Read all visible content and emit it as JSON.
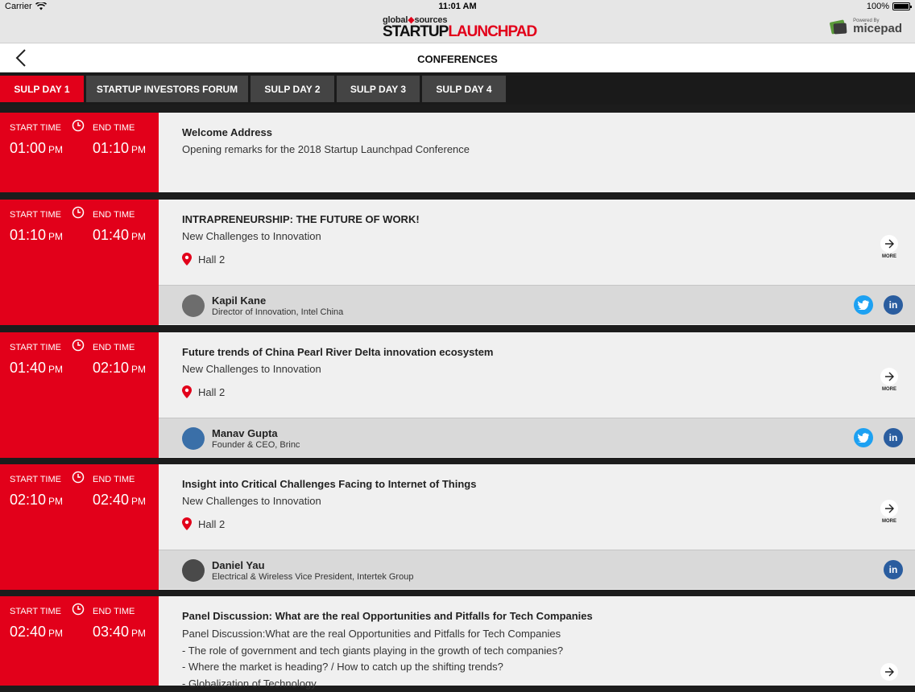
{
  "status_bar": {
    "carrier": "Carrier",
    "time": "11:01 AM",
    "battery": "100%"
  },
  "brand": {
    "small_left": "global",
    "small_right": "sources",
    "startup": "STARTUP",
    "launchpad": "LAUNCHPAD",
    "powered_by": "Powered By",
    "micepad": "micepad"
  },
  "header": {
    "title": "CONFERENCES"
  },
  "tabs": [
    {
      "label": "SULP DAY 1",
      "active": true
    },
    {
      "label": "STARTUP INVESTORS FORUM",
      "active": false
    },
    {
      "label": "SULP DAY 2",
      "active": false
    },
    {
      "label": "SULP DAY 3",
      "active": false
    },
    {
      "label": "SULP DAY 4",
      "active": false
    }
  ],
  "labels": {
    "start_time": "START TIME",
    "end_time": "END TIME",
    "pm": "PM",
    "more": "MORE"
  },
  "sessions": [
    {
      "start": "01:00",
      "end": "01:10",
      "title": "Welcome Address",
      "subtitle": "Opening remarks for the 2018 Startup Launchpad Conference"
    },
    {
      "start": "01:10",
      "end": "01:40",
      "title": "INTRAPRENEURSHIP: THE FUTURE OF WORK!",
      "subtitle": "New Challenges to Innovation",
      "location": "Hall 2",
      "speaker": {
        "name": "Kapil Kane",
        "role": "Director of Innovation, Intel China"
      }
    },
    {
      "start": "01:40",
      "end": "02:10",
      "title": "Future trends of China Pearl River Delta innovation ecosystem",
      "subtitle": "New Challenges to Innovation",
      "location": "Hall 2",
      "speaker": {
        "name": "Manav Gupta",
        "role": "Founder & CEO, Brinc"
      }
    },
    {
      "start": "02:10",
      "end": "02:40",
      "title": "Insight into Critical Challenges Facing to Internet of Things",
      "subtitle": "New Challenges to Innovation",
      "location": "Hall 2",
      "speaker": {
        "name": "Daniel Yau",
        "role": "Electrical & Wireless Vice President, Intertek Group"
      }
    },
    {
      "start": "02:40",
      "end": "03:40",
      "title": "Panel Discussion: What are the real Opportunities and Pitfalls for Tech Companies",
      "lines": [
        "Panel Discussion:What are the real Opportunities and Pitfalls for Tech Companies",
        "- The role of government and tech giants playing in the growth of tech companies?",
        "- Where the market is heading? / How to catch up the shifting trends?",
        "- Globalization of Technology"
      ]
    }
  ],
  "colors": {
    "accent": "#e2001a",
    "twitter": "#1da1f2",
    "linkedin": "#2a5d9f"
  }
}
